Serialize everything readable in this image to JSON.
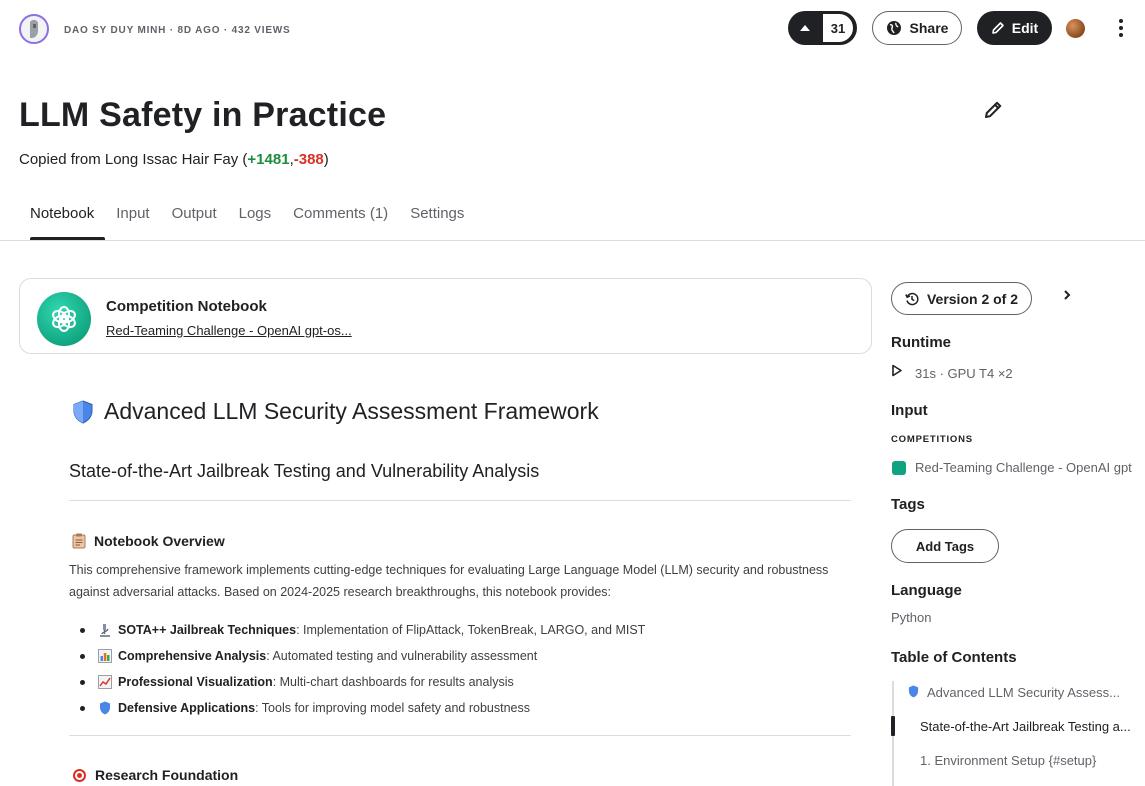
{
  "author": {
    "name": "DAO SY DUY MINH",
    "posted": "8D AGO",
    "views": "432 VIEWS"
  },
  "toolbar": {
    "votes": "31",
    "share_label": "Share",
    "edit_label": "Edit"
  },
  "notebook": {
    "title": "LLM Safety in Practice",
    "copied_prefix": "Copied from Long Issac Hair Fay (",
    "diff_plus": "+1481",
    "diff_sep": ",",
    "diff_minus": "-388",
    "copied_suffix": ")"
  },
  "tabs": [
    {
      "label": "Notebook",
      "active": true
    },
    {
      "label": "Input"
    },
    {
      "label": "Output"
    },
    {
      "label": "Logs"
    },
    {
      "label": "Comments (1)"
    },
    {
      "label": "Settings"
    }
  ],
  "competition": {
    "label": "Competition Notebook",
    "link": "Red-Teaming Challenge - OpenAI gpt-os..."
  },
  "content": {
    "h1": "Advanced LLM Security Assessment Framework",
    "h2": "State-of-the-Art Jailbreak Testing and Vulnerability Analysis",
    "overview_heading": "Notebook Overview",
    "overview_text": "This comprehensive framework implements cutting-edge techniques for evaluating Large Language Model (LLM) security and robustness against adversarial attacks. Based on 2024-2025 research breakthroughs, this notebook provides:",
    "bullets": [
      {
        "bold": "SOTA++ Jailbreak Techniques",
        "rest": ": Implementation of FlipAttack, TokenBreak, LARGO, and MIST",
        "icon": "microscope-icon"
      },
      {
        "bold": "Comprehensive Analysis",
        "rest": ": Automated testing and vulnerability assessment",
        "icon": "bar-chart-icon"
      },
      {
        "bold": "Professional Visualization",
        "rest": ": Multi-chart dashboards for results analysis",
        "icon": "trend-chart-icon"
      },
      {
        "bold": "Defensive Applications",
        "rest": ": Tools for improving model safety and robustness",
        "icon": "shield-icon"
      }
    ],
    "research_heading": "Research Foundation"
  },
  "sidebar": {
    "version_label": "Version 2 of 2",
    "runtime_heading": "Runtime",
    "runtime_value": "31s · GPU T4 ×2",
    "input_heading": "Input",
    "competitions_caps": "COMPETITIONS",
    "competition_name": "Red-Teaming Challenge - OpenAI gpt",
    "tags_heading": "Tags",
    "add_tags_label": "Add Tags",
    "language_heading": "Language",
    "language_value": "Python",
    "toc_heading": "Table of Contents",
    "toc": [
      {
        "label": "Advanced LLM Security Assess..."
      },
      {
        "label": "State-of-the-Art Jailbreak Testing a...",
        "active": true
      },
      {
        "label": "1. Environment Setup {#setup}"
      }
    ]
  },
  "colors": {
    "accent_dark": "#202124",
    "diff_plus": "#1e8e3e",
    "diff_minus": "#d93025",
    "openai_green": "#10a37f"
  }
}
